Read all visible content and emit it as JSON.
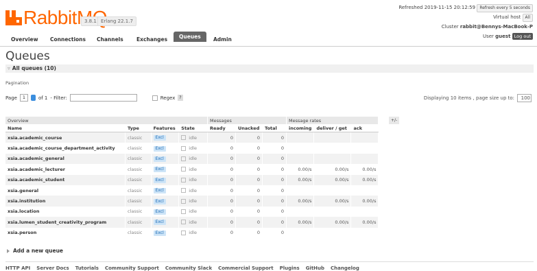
{
  "header": {
    "logo_text": "RabbitMQ.",
    "version": "3.8.1",
    "erlang": "Erlang 22.1.7"
  },
  "status": {
    "refreshed": "Refreshed 2019-11-15 20:12:59",
    "refresh_btn": "Refresh every 5 seconds",
    "vhost_label": "Virtual host",
    "vhost_value": "All",
    "cluster_label": "Cluster",
    "cluster_value": "rabbit@Bennys-MacBook-P",
    "user_label": "User",
    "user_value": "guest",
    "logout": "Log out"
  },
  "nav": {
    "tabs": [
      "Overview",
      "Connections",
      "Channels",
      "Exchanges",
      "Queues",
      "Admin"
    ],
    "active": "Queues"
  },
  "page": {
    "title": "Queues",
    "section": "All queues (10)",
    "pagination_label": "Pagination",
    "page_label": "Page",
    "page_value": "1",
    "of_label": "of 1",
    "filter_label": "- Filter:",
    "regex_label": "Regex",
    "help": "?",
    "display_info": "Displaying 10 items , page size up to:",
    "page_size": "100"
  },
  "table": {
    "groups": [
      "Overview",
      "Messages",
      "Message rates"
    ],
    "plusminus": "+/-",
    "headers": [
      "Name",
      "Type",
      "Features",
      "State",
      "Ready",
      "Unacked",
      "Total",
      "incoming",
      "deliver / get",
      "ack"
    ],
    "rows": [
      {
        "name": "xsia.academic_course",
        "type": "classic",
        "feature": "Excl",
        "state": "idle",
        "ready": "0",
        "unacked": "0",
        "total": "0",
        "incoming": "",
        "deliver": "",
        "ack": ""
      },
      {
        "name": "xsia.academic_course_department_activity",
        "type": "classic",
        "feature": "Excl",
        "state": "idle",
        "ready": "0",
        "unacked": "0",
        "total": "0",
        "incoming": "",
        "deliver": "",
        "ack": ""
      },
      {
        "name": "xsia.academic_general",
        "type": "classic",
        "feature": "Excl",
        "state": "idle",
        "ready": "0",
        "unacked": "0",
        "total": "0",
        "incoming": "",
        "deliver": "",
        "ack": ""
      },
      {
        "name": "xsia.academic_lecturer",
        "type": "classic",
        "feature": "Excl",
        "state": "idle",
        "ready": "0",
        "unacked": "0",
        "total": "0",
        "incoming": "0.00/s",
        "deliver": "0.00/s",
        "ack": "0.00/s"
      },
      {
        "name": "xsia.academic_student",
        "type": "classic",
        "feature": "Excl",
        "state": "idle",
        "ready": "0",
        "unacked": "0",
        "total": "0",
        "incoming": "0.00/s",
        "deliver": "0.00/s",
        "ack": "0.00/s"
      },
      {
        "name": "xsia.general",
        "type": "classic",
        "feature": "Excl",
        "state": "idle",
        "ready": "0",
        "unacked": "0",
        "total": "0",
        "incoming": "",
        "deliver": "",
        "ack": ""
      },
      {
        "name": "xsia.institution",
        "type": "classic",
        "feature": "Excl",
        "state": "idle",
        "ready": "0",
        "unacked": "0",
        "total": "0",
        "incoming": "0.00/s",
        "deliver": "0.00/s",
        "ack": "0.00/s"
      },
      {
        "name": "xsia.location",
        "type": "classic",
        "feature": "Excl",
        "state": "idle",
        "ready": "0",
        "unacked": "0",
        "total": "0",
        "incoming": "",
        "deliver": "",
        "ack": ""
      },
      {
        "name": "xsia.lumen_student_creativity_program",
        "type": "classic",
        "feature": "Excl",
        "state": "idle",
        "ready": "0",
        "unacked": "0",
        "total": "0",
        "incoming": "0.00/s",
        "deliver": "0.00/s",
        "ack": "0.00/s"
      },
      {
        "name": "xsia.person",
        "type": "classic",
        "feature": "Excl",
        "state": "idle",
        "ready": "0",
        "unacked": "0",
        "total": "0",
        "incoming": "",
        "deliver": "",
        "ack": ""
      }
    ]
  },
  "add_queue": "Add a new queue",
  "footer": [
    "HTTP API",
    "Server Docs",
    "Tutorials",
    "Community Support",
    "Community Slack",
    "Commercial Support",
    "Plugins",
    "GitHub",
    "Changelog"
  ],
  "colors": {
    "brand": "#ff6600",
    "active_tab": "#666666",
    "excl_bg": "#cde4f7"
  }
}
